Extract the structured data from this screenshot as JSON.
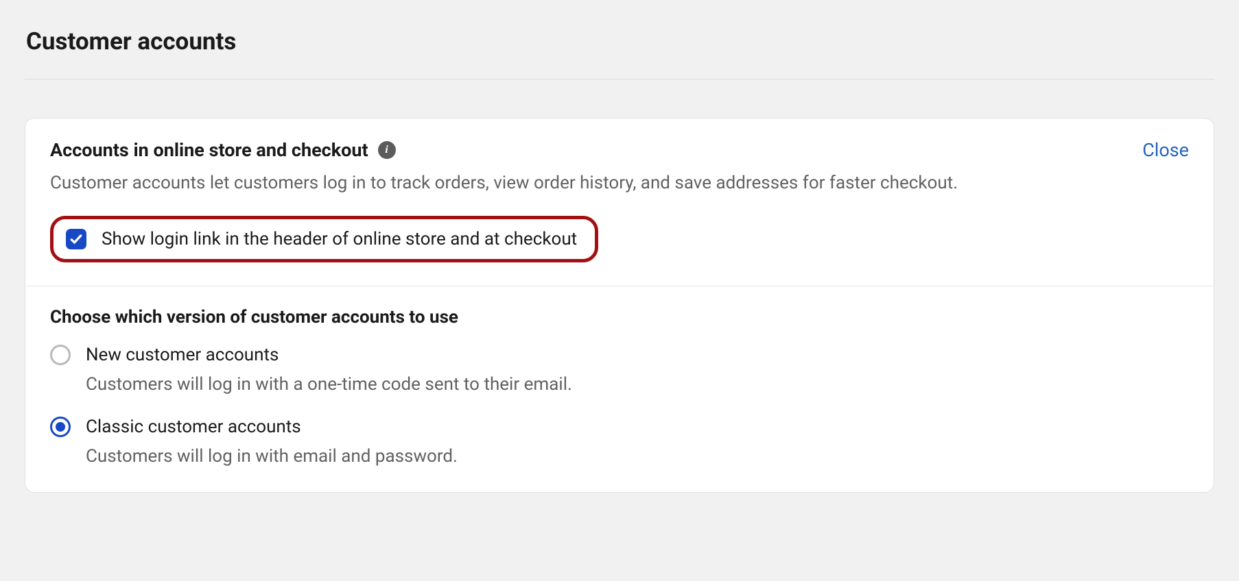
{
  "page": {
    "title": "Customer accounts"
  },
  "card": {
    "section1": {
      "title": "Accounts in online store and checkout",
      "close_label": "Close",
      "description": "Customer accounts let customers log in to track orders, view order history, and save addresses for faster checkout.",
      "checkbox": {
        "checked": true,
        "label": "Show login link in the header of online store and at checkout"
      }
    },
    "section2": {
      "title": "Choose which version of customer accounts to use",
      "options": [
        {
          "label": "New customer accounts",
          "description": "Customers will log in with a one-time code sent to their email.",
          "selected": false
        },
        {
          "label": "Classic customer accounts",
          "description": "Customers will log in with email and password.",
          "selected": true
        }
      ]
    }
  }
}
